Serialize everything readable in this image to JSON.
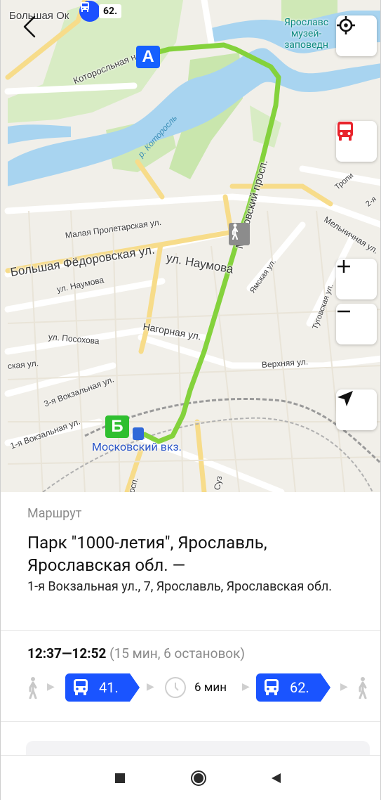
{
  "map": {
    "bus_badge_number": "62.",
    "museum_label_lines": [
      "Ярославс",
      "музей-",
      "заповедн"
    ],
    "marker_start": "А",
    "marker_end": "Б",
    "station_label": "Московский вкз.",
    "street_labels": [
      "Большая Ок",
      "Которосльная наб.",
      "р. Которосль",
      "Московский просп.",
      "Малая Пролетарская ул.",
      "Большая Фёдоровская ул.",
      "ул. Наумова",
      "ул. Наумова",
      "Нагорная ул.",
      "ул. Посохова",
      "3-я Вокзальная ул.",
      "1-я Вокзальная ул.",
      "ская ул.",
      "Ямская ул.",
      "Туговская ул.",
      "Мельничная ул.",
      "Верхняя ул.",
      "Тропи",
      "2-я",
      "Суз",
      "осп."
    ],
    "colors": {
      "route": "#84d23c",
      "water": "#a8d4f0",
      "park": "#cde7b5",
      "road": "#f7dc8a",
      "marker_a": "#1560ff",
      "marker_b": "#2fbf2f"
    },
    "icons": {
      "back": "chevron-left-icon",
      "locate": "crosshair-icon",
      "transport": "bus-icon",
      "zoom_in": "plus-icon",
      "zoom_out": "minus-icon",
      "navigate": "navigation-arrow-icon"
    }
  },
  "sheet": {
    "label": "Маршрут",
    "title": "Парк \"1000-летия\", Ярославль, Ярославская обл. —",
    "subtitle": "1-я Вокзальная ул., 7, Ярославль, Ярославская обл.",
    "time_range": "12:37—12:52",
    "details": "(15 мин, 6 остановок)",
    "segments": {
      "bus1": "41.",
      "wait": "6 мин",
      "bus2": "62."
    }
  },
  "navbar": {
    "icons": [
      "recents-square-icon",
      "home-circle-icon",
      "back-triangle-icon"
    ]
  }
}
